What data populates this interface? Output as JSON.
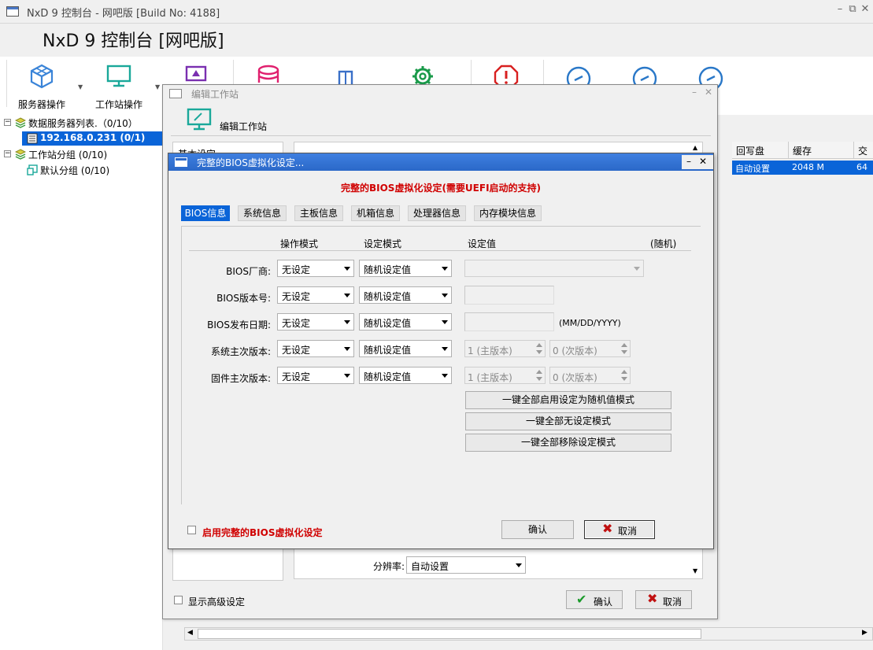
{
  "main_window": {
    "title": "NxD 9 控制台 - 网吧版 [Build No: 4188]",
    "app_title": "NxD 9 控制台 [网吧版]"
  },
  "toolbar": {
    "items": [
      {
        "label": "服务器操作",
        "icon": "server-cube-icon"
      },
      {
        "label": "工作站操作",
        "icon": "monitor-icon"
      }
    ],
    "colors": {
      "server": "#3a84d8",
      "workstation": "#1aa89a",
      "purple": "#7a2fb0",
      "db": "#e0206e",
      "door": "#3a70c8",
      "gear": "#1a9a4a",
      "stop": "#d82020",
      "gauge": "#2a78c8"
    }
  },
  "tree": {
    "db_servers": "数据服务器列表.（0/10）",
    "selected_server": "192.168.0.231 (0/1)",
    "workstation_groups": "工作站分组 (0/10)",
    "default_group": "默认分组 (0/10)"
  },
  "right_table": {
    "headers": [
      "回写盘",
      "缓存",
      "交"
    ],
    "row": [
      "自动设置",
      "2048 M",
      "64"
    ]
  },
  "edit_window": {
    "title": "编辑工作站",
    "header_label": "编辑工作站",
    "section_basic": "基本设定",
    "resolution_label": "分辨率:",
    "resolution_value": "自动设置",
    "show_advanced": "显示高级设定",
    "ok": "确认",
    "cancel": "取消"
  },
  "bios_dialog": {
    "title": "完整的BIOS虚拟化设定...",
    "banner": "完整的BIOS虚拟化设定(需要UEFI启动的支持)",
    "tabs": [
      "BIOS信息",
      "系统信息",
      "主板信息",
      "机箱信息",
      "处理器信息",
      "内存模块信息"
    ],
    "columns": {
      "mode": "操作模式",
      "setting": "设定模式",
      "value": "设定值",
      "random": "(随机)"
    },
    "rows": [
      {
        "label": "BIOS厂商:",
        "mode": "无设定",
        "setting": "随机设定值"
      },
      {
        "label": "BIOS版本号:",
        "mode": "无设定",
        "setting": "随机设定值"
      },
      {
        "label": "BIOS发布日期:",
        "mode": "无设定",
        "setting": "随机设定值",
        "hint": "(MM/DD/YYYY)"
      },
      {
        "label": "系统主次版本:",
        "mode": "无设定",
        "setting": "随机设定值",
        "major": "1 (主版本)",
        "minor": "0 (次版本)"
      },
      {
        "label": "固件主次版本:",
        "mode": "无设定",
        "setting": "随机设定值",
        "major": "1 (主版本)",
        "minor": "0 (次版本)"
      }
    ],
    "buttons": {
      "all_random": "一键全部启用设定为随机值模式",
      "all_none": "一键全部无设定模式",
      "all_remove": "一键全部移除设定模式"
    },
    "enable_label": "启用完整的BIOS虚拟化设定",
    "ok": "确认",
    "cancel": "取消"
  }
}
